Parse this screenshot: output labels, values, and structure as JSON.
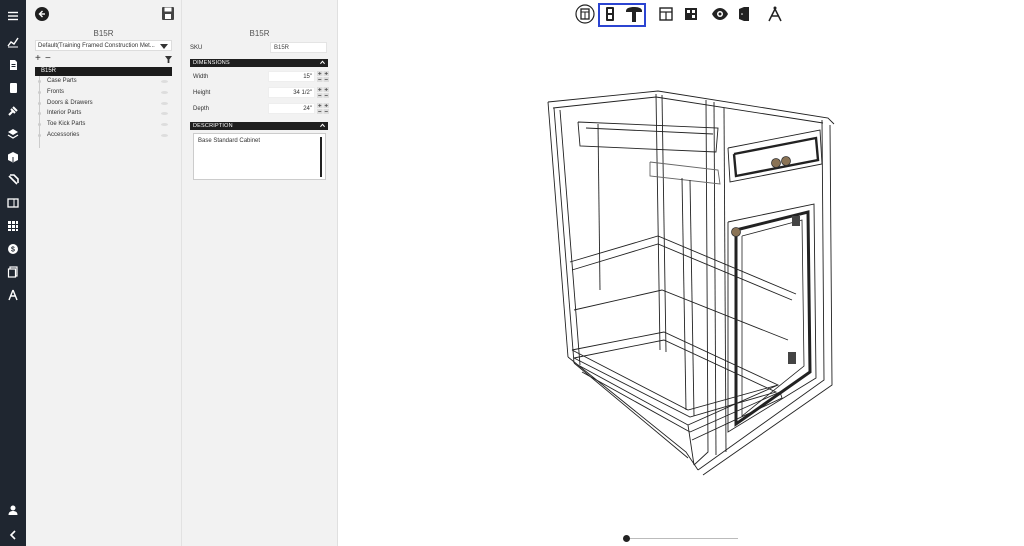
{
  "rail": {
    "icons": [
      "menu-icon",
      "analytics-icon",
      "document-icon",
      "book-icon",
      "tools-icon",
      "layers-icon",
      "box-icon",
      "catalog-icon",
      "panel-icon",
      "grid-icon",
      "pricing-icon",
      "files-icon",
      "compass-icon",
      "user-icon",
      "collapse-icon"
    ]
  },
  "left_panel": {
    "title": "B15R",
    "dropdown_value": "Default(Training Framed Construction Met...",
    "tree": {
      "root": "B15R",
      "items": [
        "Case Parts",
        "Fronts",
        "Doors & Drawers",
        "Interior Parts",
        "Toe Kick Parts",
        "Accessories"
      ]
    }
  },
  "detail_panel": {
    "title": "B15R",
    "sku_label": "SKU",
    "sku_value": "B15R",
    "dimensions_header": "DIMENSIONS",
    "dimensions": [
      {
        "label": "Width",
        "value": "15\""
      },
      {
        "label": "Height",
        "value": "34 1/2\""
      },
      {
        "label": "Depth",
        "value": "24\""
      }
    ],
    "description_header": "DESCRIPTION",
    "description_text": "Base Standard Cabinet"
  },
  "viewer": {
    "toolbar_icons": [
      "cabinet-view-icon",
      "door-view-icon",
      "hinge-icon",
      "layout-icon",
      "components-icon",
      "visibility-icon",
      "door-open-icon",
      "measure-icon"
    ],
    "selected_group": [
      "door-view-icon",
      "hinge-icon"
    ],
    "accent_color": "#2b44d1",
    "zoom_fraction": 0.0
  }
}
